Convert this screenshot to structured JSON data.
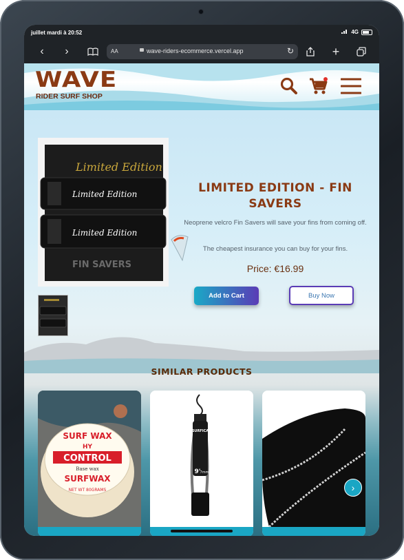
{
  "status": {
    "time": "juillet mardi à 20:52",
    "network": "4G"
  },
  "browser": {
    "text_size_label": "AA",
    "url": "wave-riders-ecommerce.vercel.app"
  },
  "site": {
    "logo_title": "WAVE",
    "logo_subtitle": "RIDER SURF SHOP"
  },
  "product": {
    "title": "Limited Edition - Fin Savers",
    "description": "Neoprene velcro Fin Savers will save your fins from coming off.",
    "tagline": "The cheapest insurance you can buy for your fins.",
    "price": "Price: €16.99",
    "add_to_cart_label": "Add to Cart",
    "buy_now_label": "Buy Now",
    "image_text": {
      "top": "Limited Edition",
      "strap": "Limited Edition",
      "label": "FIN SAVERS"
    }
  },
  "similar": {
    "title": "Similar Products",
    "cards": [
      {
        "image_text": [
          "SURF WAX",
          "HY",
          "CONTROL",
          "Base wax",
          "SURFWAX",
          "NET WT 80GRAMS"
        ]
      },
      {
        "image_text": [
          "SURFICA",
          "9'",
          "7mm"
        ]
      },
      {
        "image_text": []
      }
    ]
  },
  "colors": {
    "brand": "#8a3a14",
    "accent": "#1aa6c4",
    "purple": "#5a3cb6"
  }
}
